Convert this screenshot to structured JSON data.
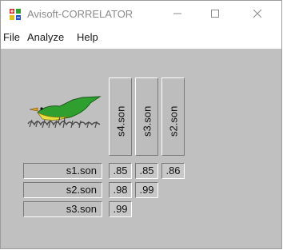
{
  "window": {
    "title": "Avisoft-CORRELATOR",
    "icon": "avisoft-app-icon",
    "controls": {
      "minimize_icon": "minimize-icon",
      "maximize_icon": "maximize-icon",
      "close_icon": "close-icon"
    }
  },
  "menu": {
    "file": "File",
    "analyze": "Analyze",
    "help": "Help"
  },
  "matrix": {
    "columns": [
      "s4.son",
      "s3.son",
      "s2.son"
    ],
    "rows": [
      {
        "label": "s1.son",
        "values": [
          ".85",
          ".85",
          ".86"
        ]
      },
      {
        "label": "s2.son",
        "values": [
          ".98",
          ".99"
        ]
      },
      {
        "label": "s3.son",
        "values": [
          ".99"
        ]
      }
    ]
  },
  "colors": {
    "client_bg": "#c0c0c0",
    "bird_body": "#2fa02f",
    "bird_belly": "#e8e040"
  }
}
